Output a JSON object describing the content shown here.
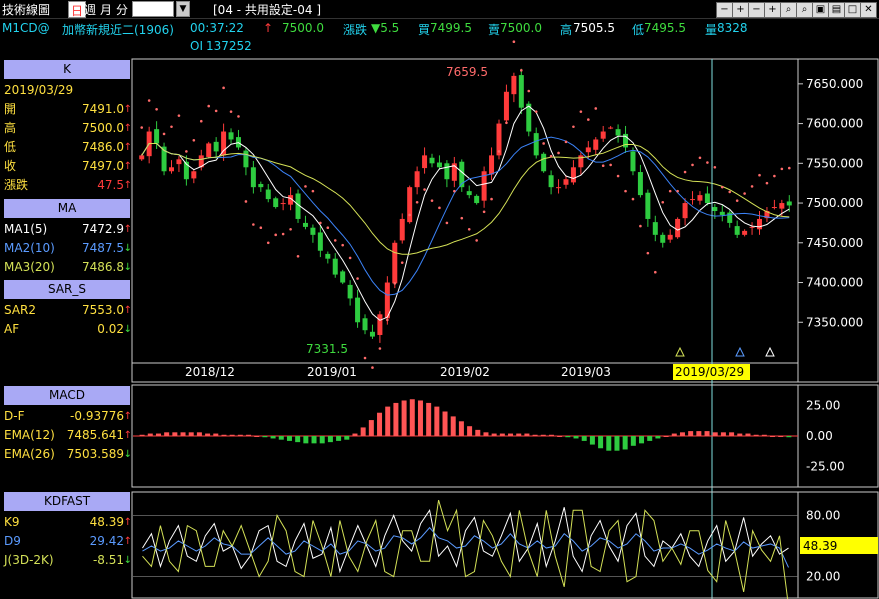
{
  "toolbar": {
    "title": "技術線圖",
    "periods": [
      "日",
      "週",
      "月",
      "分"
    ],
    "period_selected": "日",
    "settings_title": "[04 - 共用設定-04 ]",
    "window_buttons": [
      "−",
      "+",
      "−",
      "+",
      "⌕",
      "⌕",
      "▣",
      "▤",
      "□",
      "✕"
    ]
  },
  "quote": {
    "symbol": "M1CD@",
    "name": "加幣新規近二(1906)",
    "time": "00:37:22",
    "arrow": "↑",
    "price": "7500.0",
    "change_label": "漲跌",
    "change": "▼5.5",
    "bid_label": "買",
    "bid": "7499.5",
    "ask_label": "賣",
    "ask": "7500.0",
    "high_label": "高",
    "high": "7505.5",
    "low_label": "低",
    "low": "7495.5",
    "vol_label": "量",
    "vol": "8328",
    "oi_label": "OI",
    "oi": "137252"
  },
  "panel": {
    "k_header": "K",
    "date": "2019/03/29",
    "k_rows": [
      {
        "label": "開",
        "value": "7491.0",
        "arrow": "↑"
      },
      {
        "label": "高",
        "value": "7500.0",
        "arrow": "↑"
      },
      {
        "label": "低",
        "value": "7486.0",
        "arrow": "↑"
      },
      {
        "label": "收",
        "value": "7497.0",
        "arrow": "↑"
      },
      {
        "label": "漲跌",
        "value": "47.5",
        "arrow": "↑"
      }
    ],
    "ma_header": "MA",
    "ma_rows": [
      {
        "label": "MA1(5)",
        "value": "7472.9",
        "arrow": "↑"
      },
      {
        "label": "MA2(10)",
        "value": "7487.5",
        "arrow": "↓"
      },
      {
        "label": "MA3(20)",
        "value": "7486.8",
        "arrow": "↓"
      }
    ],
    "sar_header": "SAR_S",
    "sar_rows": [
      {
        "label": "SAR2",
        "value": "7553.0",
        "arrow": "↑"
      },
      {
        "label": "AF",
        "value": "0.02",
        "arrow": "↓"
      }
    ],
    "macd_header": "MACD",
    "macd_rows": [
      {
        "label": "D-F",
        "value": "-0.93776",
        "arrow": "↑"
      },
      {
        "label": "EMA(12)",
        "value": "7485.641",
        "arrow": "↑"
      },
      {
        "label": "EMA(26)",
        "value": "7503.589",
        "arrow": "↓"
      }
    ],
    "kd_header": "KDFAST",
    "kd_rows": [
      {
        "label": "K9",
        "value": "48.39",
        "arrow": "↑"
      },
      {
        "label": "D9",
        "value": "29.42",
        "arrow": "↑"
      },
      {
        "label": "J(3D-2K)",
        "value": "-8.51",
        "arrow": "↓"
      }
    ]
  },
  "colors": {
    "up": "#ff3b3b",
    "down": "#2ecc40",
    "ma1": "#ffffff",
    "ma2": "#3b82f6",
    "ma3": "#d4e157",
    "sar": "#ff6b6b",
    "panel_header": "#a9a9f5"
  },
  "chart_data": [
    {
      "type": "candlestick",
      "title": "",
      "ylim": [
        7300,
        7680
      ],
      "yticks": [
        "7650.000",
        "7600.000",
        "7550.000",
        "7500.000",
        "7450.000",
        "7400.000",
        "7350.000"
      ],
      "ytick_values": [
        7650,
        7600,
        7550,
        7500,
        7450,
        7400,
        7350
      ],
      "xticks": [
        "2018/12",
        "2019/01",
        "2019/02",
        "2019/03"
      ],
      "cursor_date": "2019/03/29",
      "annotations": {
        "max": "7659.5",
        "min": "7331.5"
      },
      "grid": false,
      "candles_close": [
        7560,
        7590,
        7575,
        7540,
        7545,
        7555,
        7530,
        7540,
        7560,
        7575,
        7565,
        7590,
        7580,
        7570,
        7545,
        7520,
        7520,
        7505,
        7495,
        7500,
        7510,
        7480,
        7470,
        7460,
        7440,
        7430,
        7410,
        7400,
        7380,
        7350,
        7340,
        7332,
        7360,
        7400,
        7450,
        7480,
        7520,
        7540,
        7560,
        7550,
        7545,
        7530,
        7550,
        7520,
        7510,
        7500,
        7540,
        7560,
        7600,
        7640,
        7660,
        7620,
        7590,
        7560,
        7540,
        7520,
        7520,
        7530,
        7545,
        7560,
        7570,
        7580,
        7590,
        7595,
        7585,
        7570,
        7540,
        7510,
        7480,
        7460,
        7450,
        7460,
        7480,
        7500,
        7505,
        7510,
        7500,
        7490,
        7485,
        7475,
        7460,
        7465,
        7470,
        7480,
        7490,
        7495,
        7500,
        7497
      ]
    },
    {
      "type": "bar",
      "title": "MACD",
      "ylim": [
        -40,
        40
      ],
      "yticks": [
        "25.00",
        "0.00",
        "-25.00"
      ],
      "ytick_values": [
        25,
        0,
        -25
      ],
      "values": [
        1,
        2,
        2,
        3,
        3,
        3,
        3,
        3,
        2,
        2,
        1,
        1,
        1,
        1,
        0,
        -1,
        -2,
        -3,
        -4,
        -5,
        -6,
        -6,
        -6,
        -5,
        -4,
        -3,
        2,
        7,
        13,
        19,
        24,
        27,
        29,
        30,
        29,
        27,
        24,
        20,
        16,
        12,
        8,
        5,
        3,
        2,
        2,
        2,
        2,
        2,
        1,
        1,
        1,
        0,
        -1,
        -2,
        -4,
        -7,
        -10,
        -12,
        -12,
        -11,
        -8,
        -6,
        -4,
        -2,
        0,
        2,
        3,
        4,
        4,
        4,
        3,
        3,
        3,
        2,
        2,
        1,
        1,
        0,
        0,
        -1
      ]
    },
    {
      "type": "line",
      "title": "KDFAST",
      "ylim": [
        0,
        100
      ],
      "yticks": [
        "80.00",
        "20.00"
      ],
      "ytick_values": [
        80,
        20
      ],
      "current": "48.39",
      "series": [
        {
          "name": "K9",
          "values": [
            48,
            62,
            30,
            55,
            70,
            40,
            35,
            60,
            72,
            45,
            50,
            28,
            40,
            65,
            70,
            35,
            30,
            55,
            72,
            38,
            42,
            68,
            25,
            48,
            70,
            50,
            30,
            60,
            80,
            55,
            45,
            72,
            85,
            40,
            50,
            30,
            65,
            78,
            45,
            40,
            60,
            82,
            35,
            48,
            72,
            30,
            55,
            88,
            40,
            25,
            60,
            75,
            50,
            35,
            70,
            82,
            40,
            30,
            55,
            48,
            62,
            40,
            30,
            55,
            70,
            35,
            45,
            78,
            40,
            52,
            60,
            42,
            48
          ]
        },
        {
          "name": "D9",
          "values": [
            45,
            50,
            45,
            48,
            55,
            50,
            45,
            50,
            58,
            52,
            50,
            42,
            42,
            50,
            58,
            50,
            42,
            45,
            55,
            50,
            45,
            52,
            42,
            45,
            55,
            52,
            45,
            48,
            60,
            58,
            52,
            58,
            68,
            58,
            55,
            48,
            50,
            60,
            55,
            48,
            52,
            62,
            52,
            48,
            55,
            48,
            50,
            62,
            55,
            45,
            50,
            58,
            55,
            48,
            52,
            62,
            55,
            45,
            48,
            48,
            52,
            48,
            42,
            46,
            52,
            48,
            45,
            54,
            48,
            50,
            52,
            48,
            29
          ]
        },
        {
          "name": "J(3D-2K)",
          "values": [
            40,
            30,
            70,
            35,
            25,
            70,
            65,
            30,
            30,
            65,
            50,
            70,
            45,
            20,
            35,
            80,
            65,
            25,
            20,
            75,
            50,
            20,
            75,
            40,
            25,
            55,
            75,
            25,
            20,
            65,
            65,
            35,
            35,
            95,
            65,
            85,
            20,
            25,
            75,
            60,
            35,
            20,
            85,
            45,
            20,
            85,
            40,
            10,
            85,
            85,
            30,
            25,
            65,
            75,
            15,
            20,
            85,
            75,
            35,
            48,
            32,
            65,
            65,
            26,
            15,
            75,
            45,
            5,
            65,
            46,
            35,
            60,
            -9
          ]
        }
      ]
    }
  ]
}
